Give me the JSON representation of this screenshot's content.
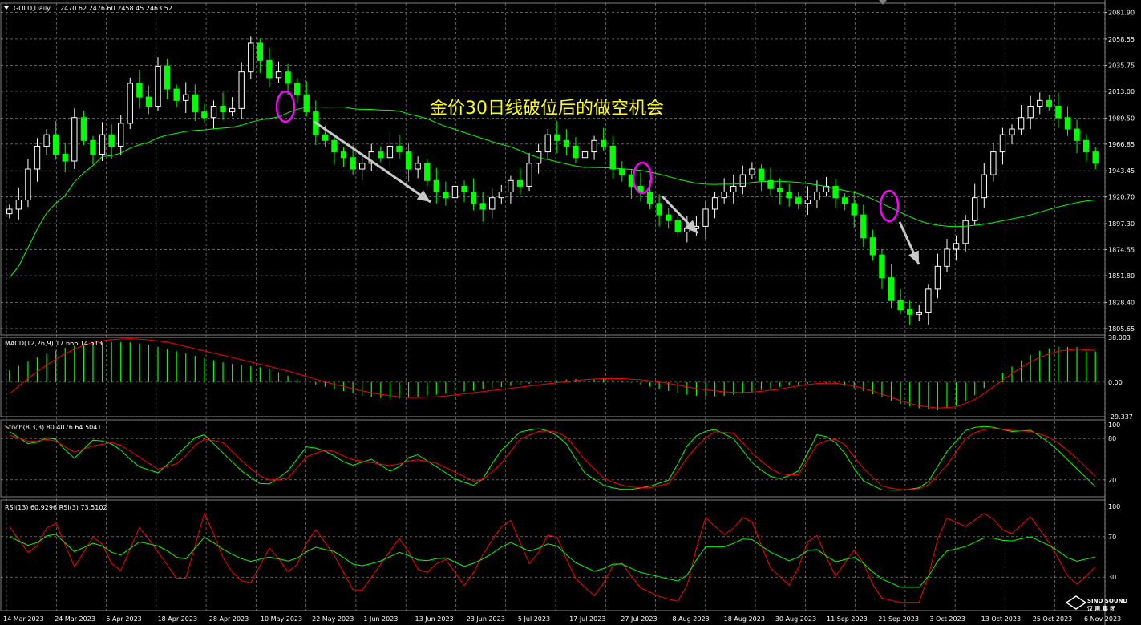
{
  "header": {
    "symbol": "GOLD,Daily",
    "ohlc": "2470.62 2476.60 2458.45 2463.52"
  },
  "annotation": "金价30日线破位后的做空机会",
  "logo": {
    "line1": "SINO SOUND",
    "line2": "汉 声 集 团"
  },
  "colors": {
    "background": "#000000",
    "grid": "#c0c0c0",
    "bull_candle": "#ffffff",
    "bear_candle": "#00ff00",
    "ma_line": "#00ff00",
    "macd_hist": "#00ff00",
    "macd_signal": "#ff0000",
    "stoch_main": "#00ff00",
    "stoch_signal": "#ff0000",
    "rsi_fast": "#ff0000",
    "rsi_slow": "#00ff00",
    "annotation_text": "#ffff00",
    "highlight_ellipse": "#ff00ff",
    "arrow": "#c8c8c8"
  },
  "chart_data": [
    {
      "type": "candlestick",
      "title": "GOLD,Daily",
      "ylim": [
        1800,
        2090
      ],
      "y_ticks": [
        "2081.90",
        "2058.55",
        "2035.75",
        "2013.00",
        "1989.50",
        "1966.85",
        "1943.45",
        "1920.70",
        "1897.30",
        "1874.55",
        "1851.80",
        "1828.40",
        "1805.65"
      ],
      "x_ticks": [
        "14 Mar 2023",
        "24 Mar 2023",
        "5 Apr 2023",
        "18 Apr 2023",
        "28 Apr 2023",
        "10 May 2023",
        "22 May 2023",
        "1 Jun 2023",
        "13 Jun 2023",
        "23 Jun 2023",
        "5 Jul 2023",
        "17 Jul 2023",
        "27 Jul 2023",
        "8 Aug 2023",
        "18 Aug 2023",
        "30 Aug 2023",
        "11 Sep 2023",
        "21 Sep 2023",
        "3 Oct 2023",
        "13 Oct 2023",
        "25 Oct 2023",
        "6 Nov 2023"
      ],
      "close_path": [
        1910,
        1918,
        1945,
        1965,
        1975,
        1958,
        1952,
        1990,
        1970,
        1958,
        1975,
        1965,
        1985,
        2020,
        2008,
        2000,
        2035,
        2015,
        2005,
        2010,
        1995,
        1990,
        2000,
        1995,
        1998,
        2030,
        2055,
        2040,
        2025,
        2030,
        2020,
        2010,
        1995,
        1975,
        1970,
        1960,
        1955,
        1945,
        1950,
        1960,
        1955,
        1965,
        1960,
        1945,
        1950,
        1935,
        1925,
        1920,
        1930,
        1925,
        1915,
        1910,
        1920,
        1925,
        1935,
        1930,
        1950,
        1960,
        1975,
        1970,
        1965,
        1955,
        1960,
        1970,
        1965,
        1945,
        1940,
        1930,
        1925,
        1915,
        1905,
        1900,
        1890,
        1893,
        1895,
        1910,
        1920,
        1925,
        1930,
        1940,
        1945,
        1935,
        1928,
        1925,
        1920,
        1915,
        1918,
        1925,
        1930,
        1920,
        1915,
        1905,
        1885,
        1870,
        1850,
        1830,
        1822,
        1818,
        1820,
        1840,
        1860,
        1875,
        1880,
        1900,
        1920,
        1940,
        1960,
        1975,
        1980,
        1990,
        2000,
        2005,
        2000,
        1990,
        1980,
        1970,
        1960,
        1950
      ]
    },
    {
      "type": "bar",
      "title": "MACD(12,26,9) 17.666 14.513",
      "ylim": [
        -29.337,
        38.003
      ],
      "y_ticks": [
        "38.003",
        "0.00",
        "-29.337"
      ],
      "hist_path": [
        10,
        18,
        25,
        30,
        33,
        34,
        34,
        32,
        28,
        24,
        20,
        16,
        14,
        12,
        6,
        0,
        -4,
        -8,
        -12,
        -14,
        -14,
        -12,
        -10,
        -8,
        -6,
        -4,
        -2,
        0,
        2,
        3,
        3,
        1,
        -2,
        -6,
        -10,
        -12,
        -12,
        -10,
        -7,
        -4,
        -2,
        0,
        -2,
        -6,
        -12,
        -18,
        -22,
        -24,
        -20,
        -10,
        4,
        16,
        26,
        30,
        30,
        26
      ],
      "signal_path": [
        -10,
        4,
        16,
        26,
        33,
        36,
        37,
        36,
        34,
        30,
        26,
        22,
        18,
        14,
        10,
        5,
        0,
        -4,
        -8,
        -11,
        -13,
        -13,
        -12,
        -10,
        -8,
        -6,
        -4,
        -2,
        0,
        2,
        3,
        3,
        2,
        0,
        -3,
        -6,
        -8,
        -9,
        -8,
        -6,
        -3,
        -1,
        -1,
        -4,
        -9,
        -15,
        -20,
        -22,
        -21,
        -14,
        -2,
        10,
        20,
        26,
        28,
        27
      ]
    },
    {
      "type": "line",
      "title": "Stoch(8,3,3) 80.4076 64.5041",
      "ylim": [
        0,
        100
      ],
      "y_ticks": [
        "100",
        "80",
        "20",
        "0"
      ],
      "series": [
        {
          "values": [
            90,
            70,
            85,
            50,
            80,
            70,
            40,
            30,
            60,
            90,
            60,
            30,
            10,
            30,
            70,
            60,
            40,
            50,
            30,
            60,
            40,
            20,
            10,
            60,
            90,
            95,
            80,
            30,
            10,
            5,
            10,
            20,
            80,
            95,
            80,
            40,
            20,
            30,
            90,
            70,
            20,
            5,
            5,
            10,
            60,
            95,
            98,
            90,
            92,
            70,
            40,
            10
          ]
        },
        {
          "values": [
            85,
            75,
            80,
            60,
            70,
            75,
            55,
            35,
            45,
            80,
            75,
            45,
            20,
            20,
            55,
            65,
            50,
            45,
            40,
            50,
            45,
            30,
            15,
            40,
            80,
            92,
            88,
            50,
            20,
            10,
            8,
            15,
            60,
            90,
            88,
            55,
            30,
            25,
            75,
            80,
            40,
            10,
            5,
            8,
            40,
            85,
            95,
            92,
            90,
            80,
            55,
            25
          ]
        }
      ]
    },
    {
      "type": "line",
      "title": "RSI(13) 60.9296 RSI(3) 73.5102",
      "ylim": [
        0,
        100
      ],
      "y_ticks": [
        "100",
        "70",
        "30"
      ],
      "series": [
        {
          "values": [
            80,
            50,
            90,
            40,
            75,
            30,
            80,
            50,
            20,
            95,
            40,
            20,
            60,
            30,
            80,
            50,
            10,
            40,
            70,
            30,
            50,
            20,
            60,
            90,
            40,
            80,
            30,
            10,
            50,
            20,
            10,
            5,
            90,
            70,
            95,
            40,
            20,
            80,
            30,
            60,
            10,
            5,
            5,
            90,
            80,
            95,
            70,
            90,
            60,
            20,
            40
          ]
        },
        {
          "values": [
            70,
            60,
            75,
            55,
            65,
            50,
            65,
            60,
            45,
            70,
            55,
            45,
            50,
            45,
            60,
            55,
            40,
            45,
            55,
            45,
            50,
            40,
            50,
            65,
            55,
            65,
            45,
            35,
            45,
            35,
            30,
            25,
            60,
            60,
            70,
            55,
            45,
            60,
            45,
            50,
            30,
            20,
            20,
            55,
            60,
            70,
            65,
            70,
            60,
            45,
            50
          ]
        }
      ]
    }
  ]
}
